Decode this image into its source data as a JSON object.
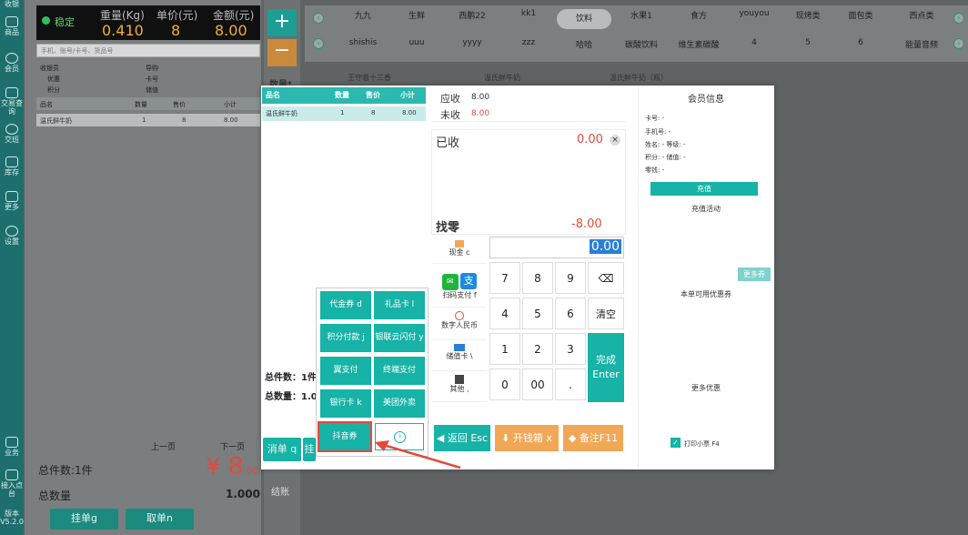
{
  "sidebar": {
    "items": [
      {
        "label": "收银"
      },
      {
        "label": "商品"
      },
      {
        "label": "会员"
      },
      {
        "label": "交易查询"
      },
      {
        "label": "交班"
      },
      {
        "label": "库存"
      },
      {
        "label": "更多"
      },
      {
        "label": "设置"
      }
    ],
    "bottom": [
      {
        "label": "业务"
      },
      {
        "label": "接入点台"
      },
      {
        "label": "版本\nV5.2.0"
      }
    ]
  },
  "scale": {
    "stable": "稳定",
    "weight_label": "重量(Kg)",
    "price_label": "单价(元)",
    "amount_label": "金额(元)",
    "weight": "0.410",
    "price": "8",
    "amount": "8.00"
  },
  "left": {
    "search_placeholder": "手机、账号/卡号、货品号",
    "member_labels": [
      "收银员",
      "优惠",
      "积分",
      "商品",
      "储值"
    ],
    "member_label2": [
      "导购",
      "卡号",
      "储值"
    ],
    "table_head": [
      "品名",
      "数量",
      "售价",
      "小计"
    ],
    "row": [
      "温氏鲜牛奶",
      "1",
      "8",
      "8.00"
    ],
    "pager_prev": "上一页",
    "pager_next": "下一页",
    "total_items": "总件数:1件",
    "total_amount_sym": "¥",
    "total_amount": "8",
    "total_amount_dec": ".00",
    "total_qty_label": "总数量",
    "total_qty": "1.000",
    "btn_hold": "挂单g",
    "btn_get": "取单n"
  },
  "categories_row1": [
    "九九",
    "生鲜",
    "西鹏22",
    "kk1",
    "饮料",
    "水果1",
    "食方",
    "youyou",
    "现烤类",
    "面包类",
    "西点类"
  ],
  "categories_row2": [
    "shishis",
    "uuu",
    "yyyy",
    "zzz",
    "哈哈",
    "碳酸饮料",
    "维生素碳酸",
    "4",
    "5",
    "6",
    "能量音频"
  ],
  "products": [
    "王守着十三香",
    "温氏鲜牛奶",
    "温氏鲜牛奶（瓶）"
  ],
  "mid": {
    "qty_label": "数量*",
    "checkout": "结账"
  },
  "order": {
    "head": [
      "品名",
      "数量",
      "售价",
      "小计"
    ],
    "row": [
      "温氏鲜牛奶",
      "1",
      "8",
      "8.00"
    ],
    "total_items": "总件数：1件",
    "total_qty": "总数量：1.0"
  },
  "pay_methods": [
    {
      "label": "代金券 d"
    },
    {
      "label": "礼品卡 l"
    },
    {
      "label": "积分付款 j"
    },
    {
      "label": "银联云闪付 y"
    },
    {
      "label": "翼支付"
    },
    {
      "label": "终端支付"
    },
    {
      "label": "银行卡 k"
    },
    {
      "label": "美团外卖"
    },
    {
      "label": "抖音券"
    }
  ],
  "buttons": {
    "cancel": "消单 q",
    "hold": "挂",
    "back": "返回 Esc",
    "drawer": "开钱箱 x",
    "remark": "备注F11",
    "done": "完成\nEnter"
  },
  "summary": {
    "receivable_label": "应收",
    "receivable": "8.00",
    "unpaid_label": "未收",
    "unpaid": "8.00",
    "paid_label": "已收",
    "paid": "0.00",
    "change_label": "找零",
    "change": "-8.00",
    "input": "0.00"
  },
  "pay_types": [
    {
      "label": "现金 c"
    },
    {
      "label": "扫码支付 f"
    },
    {
      "label": "数字人民币"
    },
    {
      "label": "储值卡 \\"
    },
    {
      "label": "其他 ,"
    }
  ],
  "keypad": [
    "7",
    "8",
    "9",
    "⌫",
    "4",
    "5",
    "6",
    "清空",
    "1",
    "2",
    "3",
    "0",
    "00",
    "."
  ],
  "member_info": {
    "title": "会员信息",
    "fields": [
      "卡号: -",
      "手机号: -",
      "姓名: -  等级: -",
      "积分: -  储值: -",
      "零钱: -"
    ],
    "recharge": "充值",
    "recharge_activity": "充值活动",
    "more_coupons_btn": "更多券",
    "available_coupons": "本单可用优惠券",
    "more_offers": "更多优惠",
    "print_receipt": "打印小票 F4"
  },
  "colors": {
    "teal": "#16b3a6",
    "orange": "#f0a857",
    "red": "#e24a3c"
  }
}
